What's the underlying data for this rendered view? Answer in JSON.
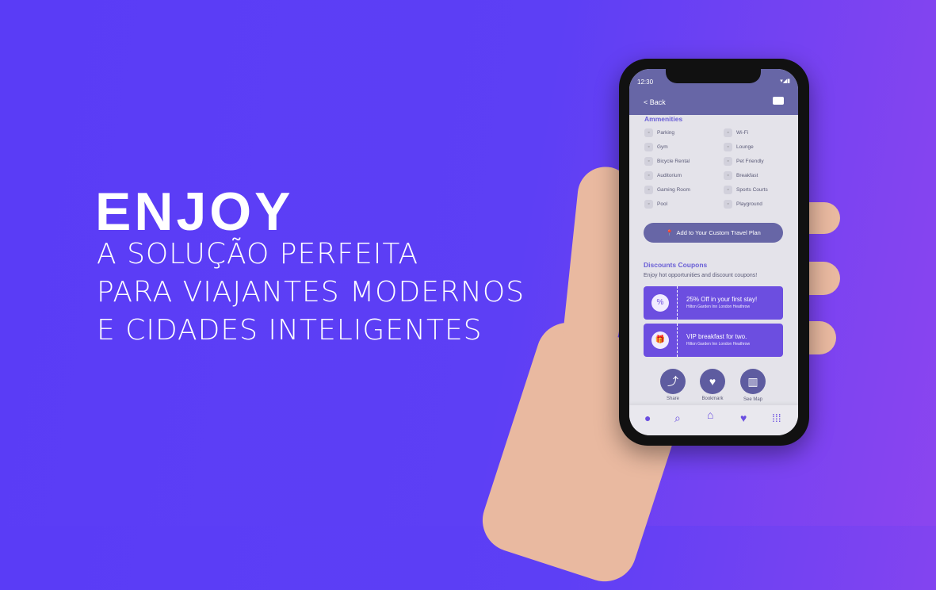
{
  "hero": {
    "title": "ENJOY",
    "lines": [
      "A SOLUÇÃO PERFEITA",
      "PARA VIAJANTES MODERNOS",
      "E CIDADES INTELIGENTES"
    ]
  },
  "phone": {
    "time": "12:30",
    "header": {
      "back": "< Back",
      "icon": "mail-icon"
    },
    "amenities": {
      "title": "Ammenities",
      "items": [
        "Parking",
        "Wi-Fi",
        "Gym",
        "Lounge",
        "Bicycle Rental",
        "Pet Friendly",
        "Auditorium",
        "Breakfast",
        "Gaming Room",
        "Sports Courts",
        "Pool",
        "Playground"
      ]
    },
    "cta": "Add to Your Custom Travel Plan",
    "coupons": {
      "title": "Discounts Coupons",
      "subtitle": "Enjoy hot opportunities and discount coupons!",
      "items": [
        {
          "title": "25% Off in your first stay!",
          "sub": "Hilton Garden Inn London Heathrow",
          "icon": "percent-icon"
        },
        {
          "title": "VIP breakfast for two.",
          "sub": "Hilton Garden Inn London Heathrow",
          "icon": "gift-icon"
        }
      ]
    },
    "actions": [
      "Share",
      "Bookmark",
      "See Map"
    ],
    "nav": [
      "profile-icon",
      "search-icon",
      "home-icon",
      "heart-icon",
      "grid-icon"
    ]
  },
  "colors": {
    "accent": "#6c4ee0",
    "header": "#6766a6",
    "background": "#5a3cf6"
  }
}
